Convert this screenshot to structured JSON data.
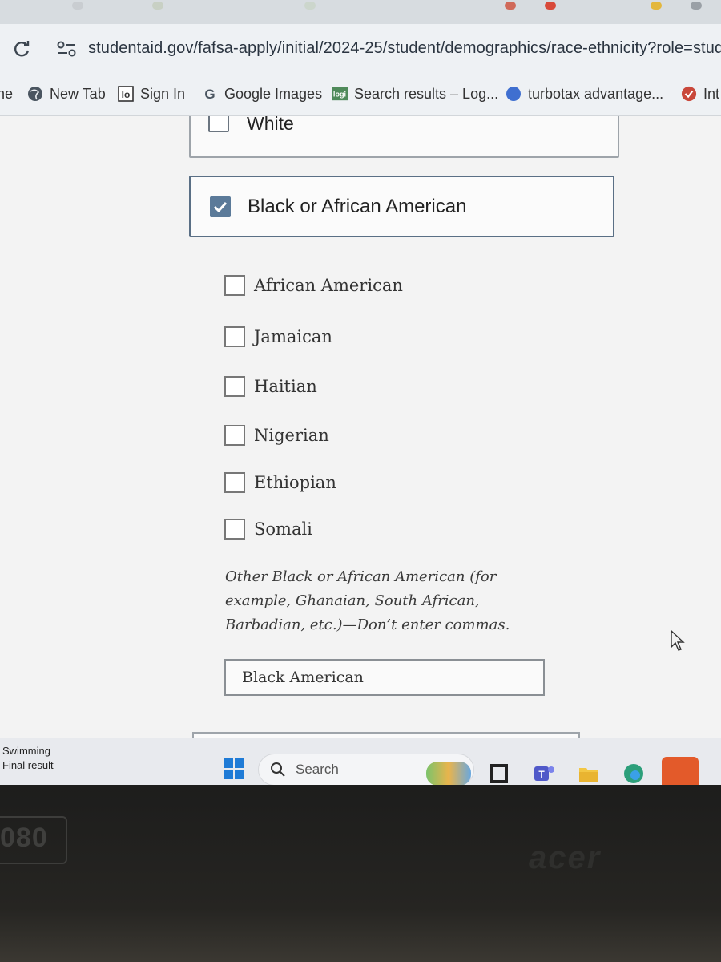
{
  "browser": {
    "url": "studentaid.gov/fafsa-apply/initial/2024-25/student/demographics/race-ethnicity?role=stud",
    "bookmarks": [
      {
        "label": "ne",
        "icon": "bookmark-icon"
      },
      {
        "label": "New Tab",
        "icon": "globe-icon"
      },
      {
        "label": "Sign In",
        "icon": "lo-logo-icon"
      },
      {
        "label": "Google Images",
        "icon": "google-icon"
      },
      {
        "label": "Search results – Log...",
        "icon": "logo-icon"
      },
      {
        "label": "turbotax advantage...",
        "icon": "blue-circle-icon"
      },
      {
        "label": "Int",
        "icon": "check-badge-icon"
      }
    ]
  },
  "form": {
    "white_option": {
      "label": "White",
      "checked": false
    },
    "black_option": {
      "label": "Black or African American",
      "checked": true
    },
    "sub_options": [
      {
        "label": "African American",
        "checked": false
      },
      {
        "label": "Jamaican",
        "checked": false
      },
      {
        "label": "Haitian",
        "checked": false
      },
      {
        "label": "Nigerian",
        "checked": false
      },
      {
        "label": "Ethiopian",
        "checked": false
      },
      {
        "label": "Somali",
        "checked": false
      }
    ],
    "other_hint_lines": [
      "Other Black or African American (for",
      "example, Ghanaian, South African,",
      "Barbadian, etc.)—Don’t enter commas."
    ],
    "other_value": "Black American"
  },
  "taskbar": {
    "weather_title": "Swimming",
    "weather_subtitle": "Final result",
    "search_placeholder": "Search"
  },
  "device": {
    "sticker_text": "080",
    "brand": "acer"
  },
  "colors": {
    "checked_fill": "#5b7a99",
    "selected_border": "#5a6f85"
  }
}
